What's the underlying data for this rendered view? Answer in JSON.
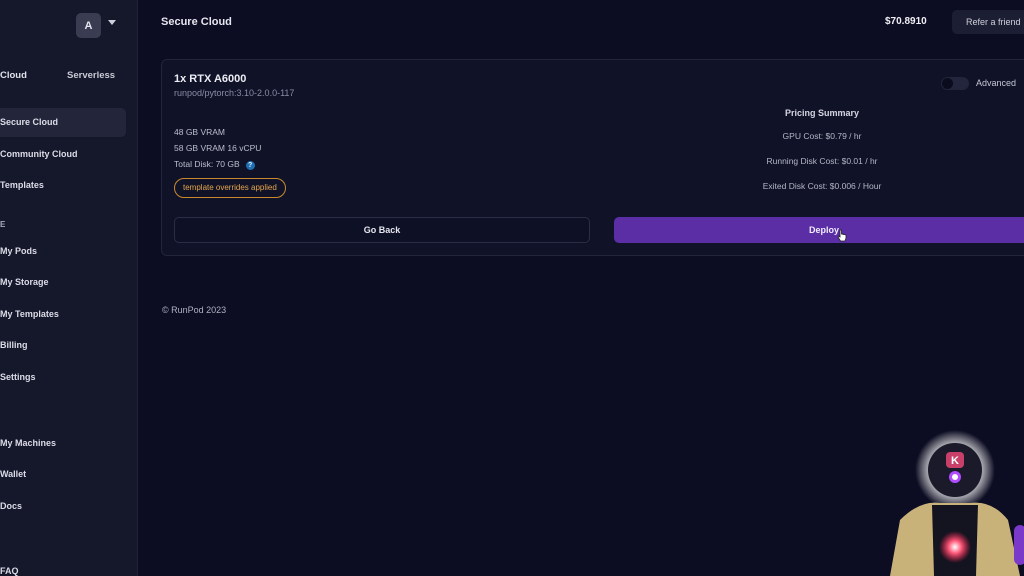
{
  "sidebar": {
    "avatar_letter": "A",
    "tabs": [
      {
        "label": "Cloud"
      },
      {
        "label": "Serverless"
      }
    ],
    "items": [
      {
        "label": "Secure Cloud"
      },
      {
        "label": "Community Cloud"
      },
      {
        "label": "Templates"
      },
      {
        "label": "My Pods"
      },
      {
        "label": "My Storage"
      },
      {
        "label": "My Templates"
      },
      {
        "label": "Billing"
      },
      {
        "label": "Settings"
      },
      {
        "label": "My Machines"
      },
      {
        "label": "Wallet"
      },
      {
        "label": "Docs"
      },
      {
        "label": "FAQ"
      }
    ],
    "section_label": "E"
  },
  "header": {
    "title": "Secure Cloud",
    "balance": "$70.8910",
    "refer_label": "Refer a friend"
  },
  "card": {
    "gpu_name": "1x RTX A6000",
    "image_name": "runpod/pytorch:3.10-2.0.0-117",
    "specs": {
      "vram": "48 GB VRAM",
      "ram_cpu": "58 GB VRAM 16 vCPU",
      "disk": "Total Disk: 70 GB"
    },
    "override_badge": "template overrides applied",
    "advanced_label": "Advanced",
    "pricing": {
      "title": "Pricing Summary",
      "gpu_cost": "GPU Cost: $0.79 / hr",
      "running_disk": "Running Disk Cost: $0.01 / hr",
      "exited_disk": "Exited Disk Cost: $0.006 / Hour"
    },
    "go_back_label": "Go Back",
    "deploy_label": "Deploy"
  },
  "footer": {
    "copyright": "© RunPod 2023"
  },
  "overlay": {
    "avatar_letter": "K"
  },
  "colors": {
    "background": "#0c0c22",
    "sidebar": "#15172b",
    "accent": "#5b2ea6",
    "badge": "#e5a64a"
  }
}
